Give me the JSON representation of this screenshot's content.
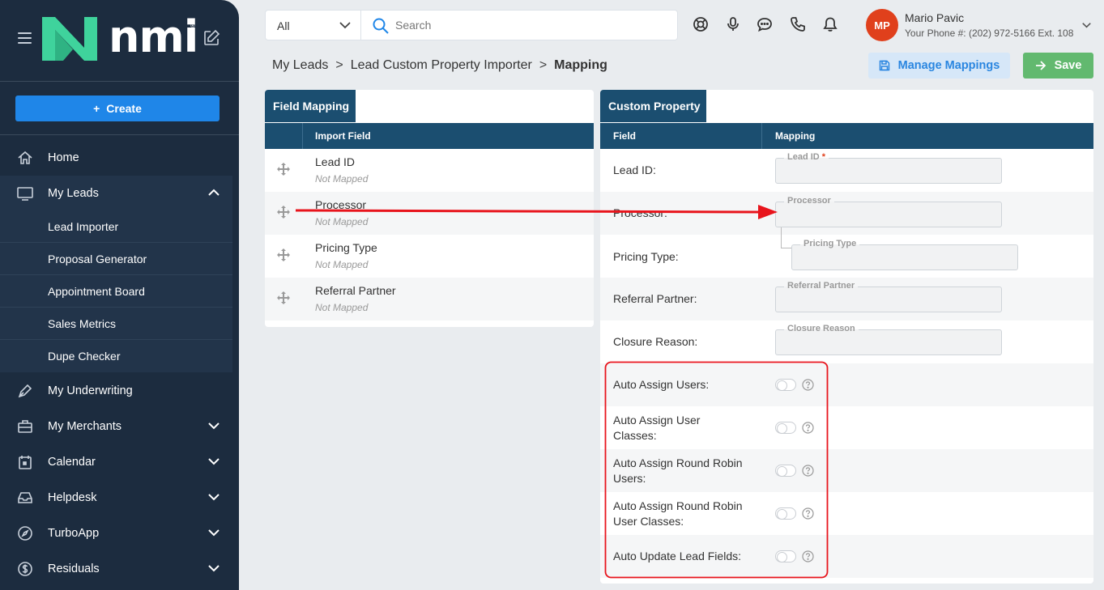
{
  "app": {
    "logo_text": "nmi",
    "logo_reg": "®"
  },
  "sidebar": {
    "create_label": "Create",
    "items": [
      {
        "label": "Home",
        "icon": "home-icon"
      },
      {
        "label": "My Leads",
        "icon": "monitor-icon",
        "expanded": true
      },
      {
        "label": "My Underwriting",
        "icon": "pen-icon"
      },
      {
        "label": "My Merchants",
        "icon": "briefcase-icon"
      },
      {
        "label": "Calendar",
        "icon": "calendar-icon"
      },
      {
        "label": "Helpdesk",
        "icon": "inbox-icon"
      },
      {
        "label": "TurboApp",
        "icon": "compass-icon"
      },
      {
        "label": "Residuals",
        "icon": "dollar-icon"
      }
    ],
    "subitems": [
      {
        "label": "Lead Importer"
      },
      {
        "label": "Proposal Generator"
      },
      {
        "label": "Appointment Board"
      },
      {
        "label": "Sales Metrics"
      },
      {
        "label": "Dupe Checker"
      }
    ]
  },
  "header": {
    "filter_value": "All",
    "search_placeholder": "Search",
    "user": {
      "initials": "MP",
      "name": "Mario Pavic",
      "phone": "Your Phone #: (202) 972-5166 Ext. 108"
    }
  },
  "breadcrumb": {
    "items": [
      "My Leads",
      "Lead Custom Property Importer"
    ],
    "current": "Mapping",
    "separator": ">"
  },
  "actions": {
    "manage_label": "Manage Mappings",
    "save_label": "Save"
  },
  "field_mapping": {
    "tab_label": "Field Mapping",
    "column_header": "Import Field",
    "rows": [
      {
        "name": "Lead ID",
        "status": "Not Mapped"
      },
      {
        "name": "Processor",
        "status": "Not Mapped"
      },
      {
        "name": "Pricing Type",
        "status": "Not Mapped"
      },
      {
        "name": "Referral Partner",
        "status": "Not Mapped"
      }
    ]
  },
  "custom_property": {
    "tab_label": "Custom Property",
    "columns": [
      "Field",
      "Mapping"
    ],
    "rows": [
      {
        "label": "Lead ID:",
        "legend": "Lead ID",
        "required_mark": "*"
      },
      {
        "label": "Processor:",
        "legend": "Processor"
      },
      {
        "label": "Pricing Type:",
        "legend": "Pricing Type"
      },
      {
        "label": "Referral Partner:",
        "legend": "Referral Partner"
      },
      {
        "label": "Closure Reason:",
        "legend": "Closure Reason"
      }
    ],
    "toggles": [
      {
        "label": "Auto Assign Users:",
        "on": false
      },
      {
        "label": "Auto Assign User Classes:",
        "on": false
      },
      {
        "label": "Auto Assign Round Robin Users:",
        "on": false
      },
      {
        "label": "Auto Assign Round Robin User Classes:",
        "on": false
      },
      {
        "label": "Auto Update Lead Fields:",
        "on": false
      }
    ]
  },
  "colors": {
    "sidebar_bg": "#1c2c3f",
    "accent_blue": "#1f86e8",
    "table_header": "#1b4e70",
    "save_green": "#62b96f",
    "avatar_red": "#e0401c",
    "annotation_red": "#e8141c",
    "logo_green": "#3fd39c"
  }
}
